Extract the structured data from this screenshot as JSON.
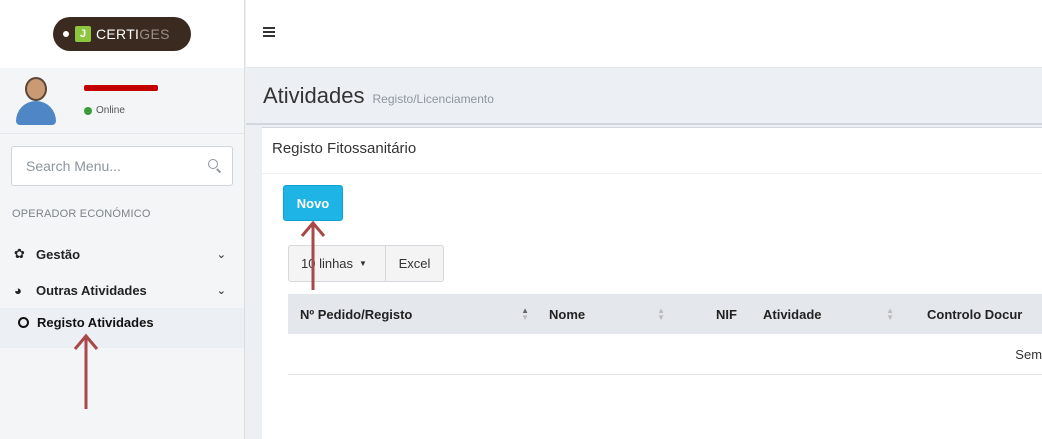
{
  "sidebar": {
    "logo": {
      "brand_main": "CERTI",
      "brand_dim": "GES"
    },
    "user": {
      "status": "Online"
    },
    "search": {
      "placeholder": "Search Menu..."
    },
    "section_header": "OPERADOR ECONÓMICO",
    "menu": [
      {
        "label": "Gestão",
        "icon": "cog-icon"
      },
      {
        "label": "Outras Atividades",
        "icon": "globe-icon"
      }
    ],
    "submenu": [
      {
        "label": "Registo Atividades",
        "icon": "circle-icon"
      }
    ]
  },
  "header": {
    "title": "Atividades",
    "subtitle": "Registo/Licenciamento"
  },
  "box": {
    "title": "Registo Fitossanitário",
    "new_button": "Novo",
    "rows_select": "10 linhas",
    "excel_button": "Excel"
  },
  "table": {
    "columns": [
      "Nº Pedido/Registo",
      "Nome",
      "NIF",
      "Atividade",
      "Controlo Docur"
    ],
    "empty_message": "Sem registos a"
  },
  "colors": {
    "accent": "#1fb4e6",
    "arrow": "#a84848",
    "status_online": "#3a9d3a"
  }
}
